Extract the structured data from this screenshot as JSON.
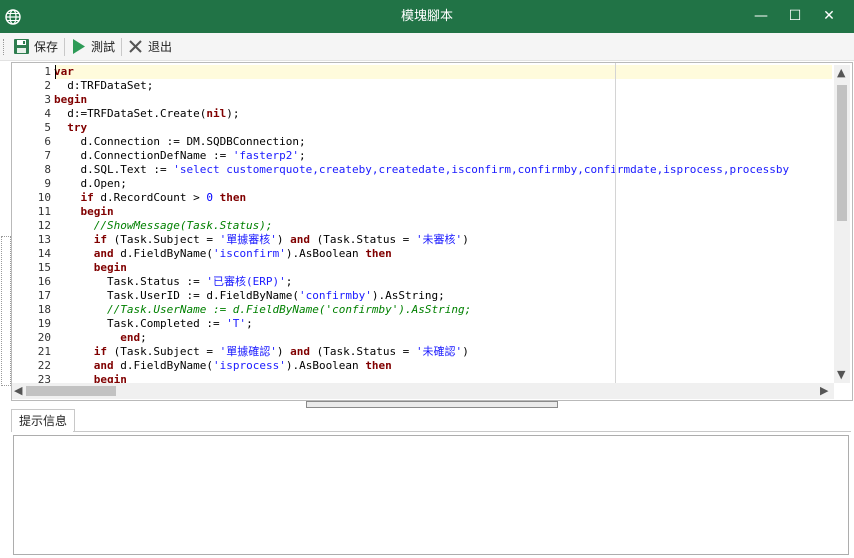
{
  "window": {
    "title": "模塊腳本",
    "minimize_glyph": "—",
    "maximize_glyph": "☐",
    "close_glyph": "✕"
  },
  "toolbar": {
    "save_label": "保存",
    "test_label": "測試",
    "exit_label": "退出"
  },
  "editor": {
    "line_numbers": [
      "1",
      "2",
      "3",
      "4",
      "5",
      "6",
      "7",
      "8",
      "9",
      "10",
      "11",
      "12",
      "13",
      "14",
      "15",
      "16",
      "17",
      "18",
      "19",
      "20",
      "21",
      "22",
      "23"
    ],
    "lines": [
      [
        {
          "t": "var",
          "c": "kw"
        }
      ],
      [
        {
          "t": "  d:TRFDataSet;",
          "c": ""
        }
      ],
      [
        {
          "t": "begin",
          "c": "kw"
        }
      ],
      [
        {
          "t": "  d:=TRFDataSet.Create(",
          "c": ""
        },
        {
          "t": "nil",
          "c": "kw"
        },
        {
          "t": ");",
          "c": ""
        }
      ],
      [
        {
          "t": "  ",
          "c": ""
        },
        {
          "t": "try",
          "c": "kw"
        }
      ],
      [
        {
          "t": "    d.Connection := DM.SQDBConnection;",
          "c": ""
        }
      ],
      [
        {
          "t": "    d.ConnectionDefName := ",
          "c": ""
        },
        {
          "t": "'fasterp2'",
          "c": "str"
        },
        {
          "t": ";",
          "c": ""
        }
      ],
      [
        {
          "t": "    d.SQL.Text := ",
          "c": ""
        },
        {
          "t": "'select customerquote,createby,createdate,isconfirm,confirmby,confirmdate,isprocess,processby",
          "c": "str"
        }
      ],
      [
        {
          "t": "    d.Open;",
          "c": ""
        }
      ],
      [
        {
          "t": "    ",
          "c": ""
        },
        {
          "t": "if",
          "c": "kw"
        },
        {
          "t": " d.RecordCount > ",
          "c": ""
        },
        {
          "t": "0",
          "c": "num"
        },
        {
          "t": " ",
          "c": ""
        },
        {
          "t": "then",
          "c": "kw"
        }
      ],
      [
        {
          "t": "    ",
          "c": ""
        },
        {
          "t": "begin",
          "c": "kw"
        }
      ],
      [
        {
          "t": "      //ShowMessage(Task.Status);",
          "c": "cm"
        }
      ],
      [
        {
          "t": "      ",
          "c": ""
        },
        {
          "t": "if",
          "c": "kw"
        },
        {
          "t": " (Task.Subject = ",
          "c": ""
        },
        {
          "t": "'單據審核'",
          "c": "str"
        },
        {
          "t": ") ",
          "c": ""
        },
        {
          "t": "and",
          "c": "kw"
        },
        {
          "t": " (Task.Status = ",
          "c": ""
        },
        {
          "t": "'未審核'",
          "c": "str"
        },
        {
          "t": ")",
          "c": ""
        }
      ],
      [
        {
          "t": "      ",
          "c": ""
        },
        {
          "t": "and",
          "c": "kw"
        },
        {
          "t": " d.FieldByName(",
          "c": ""
        },
        {
          "t": "'isconfirm'",
          "c": "str"
        },
        {
          "t": ").AsBoolean ",
          "c": ""
        },
        {
          "t": "then",
          "c": "kw"
        }
      ],
      [
        {
          "t": "      ",
          "c": ""
        },
        {
          "t": "begin",
          "c": "kw"
        }
      ],
      [
        {
          "t": "        Task.Status := ",
          "c": ""
        },
        {
          "t": "'已審核(ERP)'",
          "c": "str"
        },
        {
          "t": ";",
          "c": ""
        }
      ],
      [
        {
          "t": "        Task.UserID := d.FieldByName(",
          "c": ""
        },
        {
          "t": "'confirmby'",
          "c": "str"
        },
        {
          "t": ").AsString;",
          "c": ""
        }
      ],
      [
        {
          "t": "        //Task.UserName := d.FieldByName('confirmby').AsString;",
          "c": "cm"
        }
      ],
      [
        {
          "t": "        Task.Completed := ",
          "c": ""
        },
        {
          "t": "'T'",
          "c": "str"
        },
        {
          "t": ";",
          "c": ""
        }
      ],
      [
        {
          "t": "          ",
          "c": ""
        },
        {
          "t": "end",
          "c": "kw"
        },
        {
          "t": ";",
          "c": ""
        }
      ],
      [
        {
          "t": "      ",
          "c": ""
        },
        {
          "t": "if",
          "c": "kw"
        },
        {
          "t": " (Task.Subject = ",
          "c": ""
        },
        {
          "t": "'單據確認'",
          "c": "str"
        },
        {
          "t": ") ",
          "c": ""
        },
        {
          "t": "and",
          "c": "kw"
        },
        {
          "t": " (Task.Status = ",
          "c": ""
        },
        {
          "t": "'未確認'",
          "c": "str"
        },
        {
          "t": ")",
          "c": ""
        }
      ],
      [
        {
          "t": "      ",
          "c": ""
        },
        {
          "t": "and",
          "c": "kw"
        },
        {
          "t": " d.FieldByName(",
          "c": ""
        },
        {
          "t": "'isprocess'",
          "c": "str"
        },
        {
          "t": ").AsBoolean ",
          "c": ""
        },
        {
          "t": "then",
          "c": "kw"
        }
      ],
      [
        {
          "t": "      ",
          "c": ""
        },
        {
          "t": "begin",
          "c": "kw"
        }
      ]
    ]
  },
  "bottom_panel": {
    "tab_label": "提示信息",
    "output_text": ""
  },
  "colors": {
    "titlebar": "#217346",
    "keyword": "#800000",
    "string": "#1a1aff",
    "comment": "#008000",
    "current_line": "#fffbdc"
  },
  "icons": {
    "app": "globe-icon",
    "save": "floppy-disk-icon",
    "test": "play-icon",
    "exit": "close-x-icon"
  }
}
